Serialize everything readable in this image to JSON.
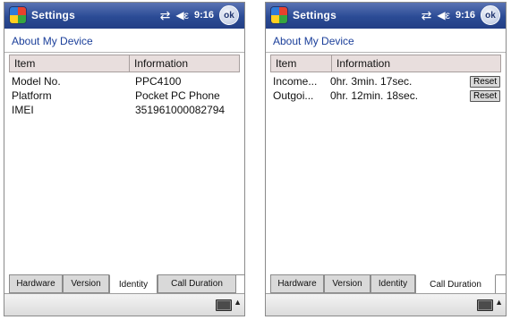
{
  "screens": [
    {
      "app_title": "Settings",
      "clock": "9:16",
      "ok_label": "ok",
      "page_title": "About My Device",
      "columns": [
        "Item",
        "Information"
      ],
      "rows": [
        {
          "item": "Model No.",
          "info": "PPC4100"
        },
        {
          "item": "Platform",
          "info": "Pocket PC Phone"
        },
        {
          "item": "IMEI",
          "info": "351961000082794"
        }
      ],
      "tabs": [
        "Hardware",
        "Version",
        "Identity",
        "Call Duration"
      ],
      "active_tab": 2
    },
    {
      "app_title": "Settings",
      "clock": "9:16",
      "ok_label": "ok",
      "page_title": "About My Device",
      "columns": [
        "Item",
        "Information"
      ],
      "rows": [
        {
          "item": "Income...",
          "info": "0hr.  3min. 17sec.",
          "action": "Reset"
        },
        {
          "item": "Outgoi...",
          "info": "0hr. 12min. 18sec.",
          "action": "Reset"
        }
      ],
      "tabs": [
        "Hardware",
        "Version",
        "Identity",
        "Call Duration"
      ],
      "active_tab": 3
    }
  ],
  "icons": {
    "start": "windows-flag-icon",
    "connectivity": "connectivity-icon",
    "volume": "speaker-icon",
    "keyboard": "keyboard-icon",
    "input_menu": "caret-up-icon"
  },
  "colors": {
    "titlebar": "#2b4b95",
    "page_title": "#1b3f9a",
    "column_header": "#e8dedd"
  }
}
